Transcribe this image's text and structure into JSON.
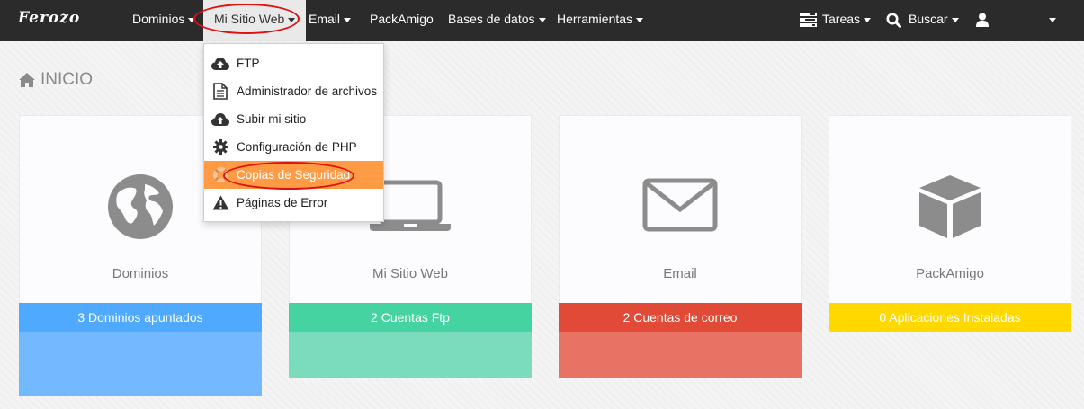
{
  "brand": {
    "logo": "Ferozo"
  },
  "nav": {
    "items": [
      {
        "label": "Dominios",
        "dropdown": true
      },
      {
        "label": "Mi Sitio Web",
        "dropdown": true,
        "active": true
      },
      {
        "label": "Email",
        "dropdown": true
      },
      {
        "label": "PackAmigo",
        "dropdown": false
      },
      {
        "label": "Bases de datos",
        "dropdown": true
      },
      {
        "label": "Herramientas",
        "dropdown": true
      }
    ],
    "right": {
      "tasks_label": "Tareas",
      "search_label": "Buscar"
    }
  },
  "dropdown": {
    "items": [
      {
        "label": "FTP",
        "icon": "cloud-upload-icon"
      },
      {
        "label": "Administrador de archivos",
        "icon": "file-icon"
      },
      {
        "label": "Subir mi sitio",
        "icon": "cloud-upload-icon"
      },
      {
        "label": "Configuración de PHP",
        "icon": "gear-icon"
      },
      {
        "label": "Copias de Seguridad",
        "icon": "lifebuoy-icon",
        "highlighted": true
      },
      {
        "label": "Páginas de Error",
        "icon": "warning-icon"
      }
    ]
  },
  "page": {
    "title": "INICIO"
  },
  "cards": [
    {
      "label": "Dominios",
      "stat": "3 Dominios apuntados",
      "icon": "globe-icon",
      "color": "#4faaff",
      "below_color": "#73b9ff"
    },
    {
      "label": "Mi Sitio Web",
      "stat": "2 Cuentas Ftp",
      "icon": "laptop-icon",
      "color": "#45d3a2",
      "below_color": "#7adcbc"
    },
    {
      "label": "Email",
      "stat": "2 Cuentas de correo",
      "icon": "envelope-icon",
      "color": "#e04a36",
      "below_color": "#e87364"
    },
    {
      "label": "PackAmigo",
      "stat": "0 Aplicaciones Instaladas",
      "icon": "cube-icon",
      "color": "#ffd800"
    }
  ],
  "colors": {
    "navbar": "#2b2b2b",
    "highlight": "#ff9b45",
    "annotation": "#e01010"
  }
}
